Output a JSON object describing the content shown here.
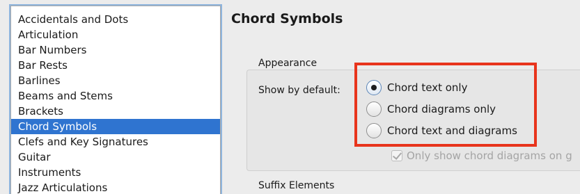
{
  "sidebar": {
    "items": [
      {
        "label": "Accidentals and Dots"
      },
      {
        "label": "Articulation"
      },
      {
        "label": "Bar Numbers"
      },
      {
        "label": "Bar Rests"
      },
      {
        "label": "Barlines"
      },
      {
        "label": "Beams and Stems"
      },
      {
        "label": "Brackets"
      },
      {
        "label": "Chord Symbols",
        "selected": true
      },
      {
        "label": "Clefs and Key Signatures"
      },
      {
        "label": "Guitar"
      },
      {
        "label": "Instruments"
      },
      {
        "label": "Jazz Articulations"
      }
    ]
  },
  "main": {
    "title": "Chord Symbols",
    "appearance": {
      "heading": "Appearance",
      "show_by_default_label": "Show by default:",
      "options": [
        {
          "label": "Chord text only",
          "checked": true
        },
        {
          "label": "Chord diagrams only",
          "checked": false
        },
        {
          "label": "Chord text and diagrams",
          "checked": false
        }
      ],
      "only_show_checkbox": {
        "label": "Only show chord diagrams on g",
        "checked": true,
        "disabled": true
      }
    },
    "suffix_heading": "Suffix Elements"
  },
  "colors": {
    "selection": "#2f74d0",
    "highlight_annotation": "#e8341c"
  }
}
